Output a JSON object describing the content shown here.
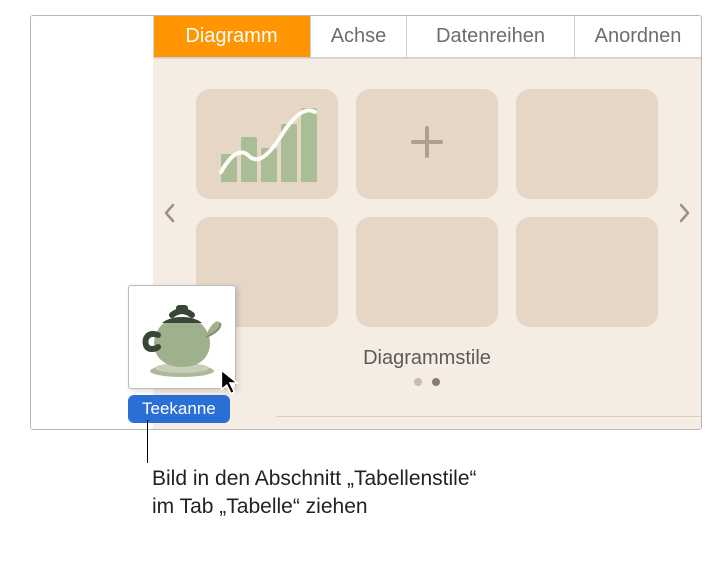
{
  "tabs": {
    "diagramm": "Diagramm",
    "achse": "Achse",
    "datenreihen": "Datenreihen",
    "anordnen": "Anordnen"
  },
  "section": {
    "title": "Diagrammstile"
  },
  "drag": {
    "label": "Teekanne"
  },
  "callout": {
    "line1": "Bild in den Abschnitt „Tabellenstile“",
    "line2": "im Tab „Tabelle“ ziehen"
  },
  "colors": {
    "accent": "#ff9500",
    "tileBg": "#e6d6c6",
    "barFill": "#a9bd97"
  }
}
